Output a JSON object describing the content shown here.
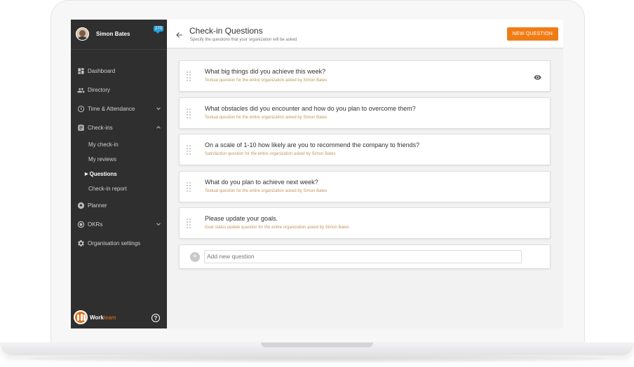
{
  "user": {
    "name": "Simon Bates",
    "badge": "270"
  },
  "sidebar": {
    "items": [
      {
        "label": "Dashboard",
        "icon": "dashboard-icon"
      },
      {
        "label": "Directory",
        "icon": "people-icon"
      },
      {
        "label": "Time & Attendance",
        "icon": "clock-icon",
        "chevron": "chevron-down-icon"
      },
      {
        "label": "Check-ins",
        "icon": "clipboard-icon",
        "chevron": "chevron-up-icon"
      },
      {
        "label": "Planner",
        "icon": "soccer-ball-icon"
      },
      {
        "label": "OKRs",
        "icon": "target-icon",
        "chevron": "chevron-down-icon"
      },
      {
        "label": "Organisation settings",
        "icon": "gear-icon"
      }
    ],
    "checkins_sub": [
      {
        "label": "My check-in"
      },
      {
        "label": "My reviews"
      },
      {
        "label": "Questions",
        "active": true
      },
      {
        "label": "Check-in report"
      }
    ]
  },
  "brand": {
    "name_a": "Work",
    "name_b": "team",
    "accent": "#e2701e"
  },
  "header": {
    "title": "Check-in Questions",
    "subtitle": "Specify the questions that your organization will be asked",
    "new_button": "NEW QUESTION"
  },
  "questions": [
    {
      "text": "What big things did you achieve this week?",
      "meta": "Textual question for the entire organization asked by Simon Bates",
      "eye": true
    },
    {
      "text": "What obstacles did you encounter and how do you plan to overcome them?",
      "meta": "Textual question for the entire organization asked by Simon Bates"
    },
    {
      "text": "On a scale of 1-10 how likely are you to recommend the company to friends?",
      "meta": "Satisfaction question for the entire organization asked by Simon Bates"
    },
    {
      "text": "What do you plan to achieve next week?",
      "meta": "Textual question for the entire organization asked by Simon Bates"
    },
    {
      "text": "Please update your goals.",
      "meta": "Goal status update question for the entire organization asked by Simon Bates"
    }
  ],
  "add_question": {
    "placeholder": "Add new question"
  },
  "colors": {
    "accent": "#f07c16",
    "sidebar_bg": "#2f2f2f",
    "meta_text": "#c2965c"
  }
}
